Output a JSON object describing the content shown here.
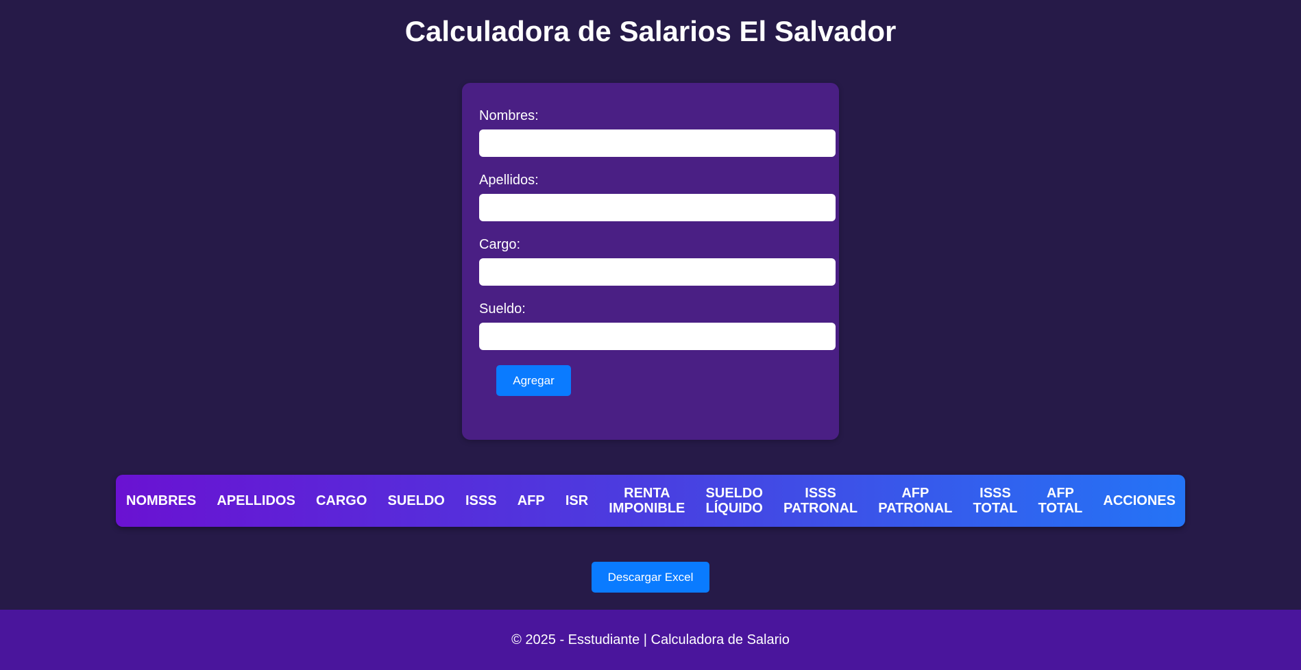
{
  "page": {
    "title": "Calculadora de Salarios El Salvador"
  },
  "form": {
    "fields": [
      {
        "label": "Nombres:",
        "value": ""
      },
      {
        "label": "Apellidos:",
        "value": ""
      },
      {
        "label": "Cargo:",
        "value": ""
      },
      {
        "label": "Sueldo:",
        "value": ""
      }
    ],
    "add_button": "Agregar"
  },
  "table": {
    "headers": [
      "NOMBRES",
      "APELLIDOS",
      "CARGO",
      "SUELDO",
      "ISSS",
      "AFP",
      "ISR",
      "RENTA\nIMPONIBLE",
      "SUELDO\nLÍQUIDO",
      "ISSS\nPATRONAL",
      "AFP\nPATRONAL",
      "ISSS\nTOTAL",
      "AFP\nTOTAL",
      "ACCIONES"
    ]
  },
  "actions": {
    "excel_button": "Descargar Excel"
  },
  "footer": {
    "text": "© 2025 - Esstudiante | Calculadora de Salario"
  },
  "colors": {
    "background": "#261a48",
    "card": "#4a1f84",
    "button": "#0a7bff",
    "footer": "#4a159c",
    "header_gradient_start": "#6a12d2",
    "header_gradient_end": "#2474f6"
  }
}
